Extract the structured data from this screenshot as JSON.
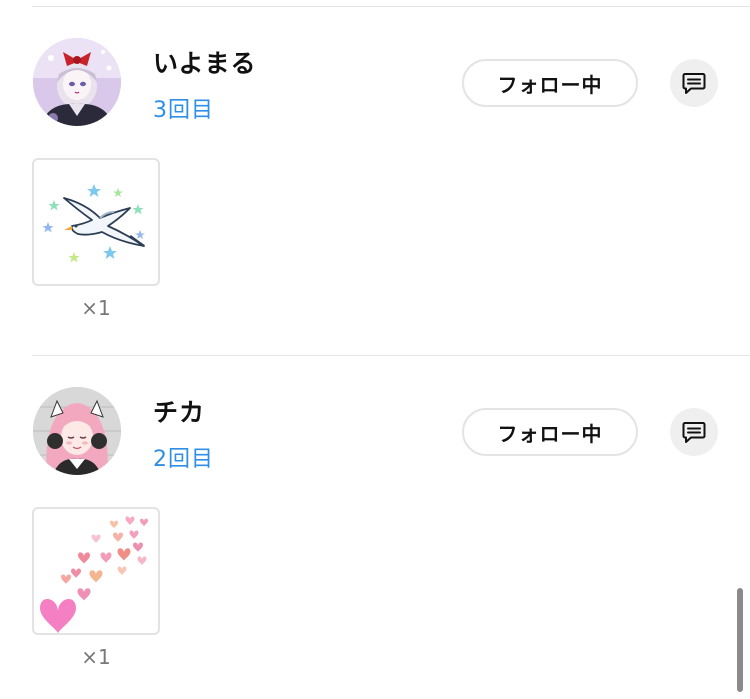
{
  "entries": [
    {
      "name": "いよまる",
      "count": "3回目",
      "follow_label": "フォロー中",
      "avatar_icon": "user-avatar",
      "message_icon": "message-icon",
      "gift": {
        "icon": "seagull-gift",
        "quantity": "×1"
      }
    },
    {
      "name": "チカ",
      "count": "2回目",
      "follow_label": "フォロー中",
      "avatar_icon": "user-avatar",
      "message_icon": "message-icon",
      "gift": {
        "icon": "hearts-gift",
        "quantity": "×1"
      }
    }
  ],
  "colors": {
    "accent": "#2f8fe6",
    "divider": "#e6e6e6",
    "button_border": "#e4e4e4",
    "message_button_bg": "#efefef"
  }
}
